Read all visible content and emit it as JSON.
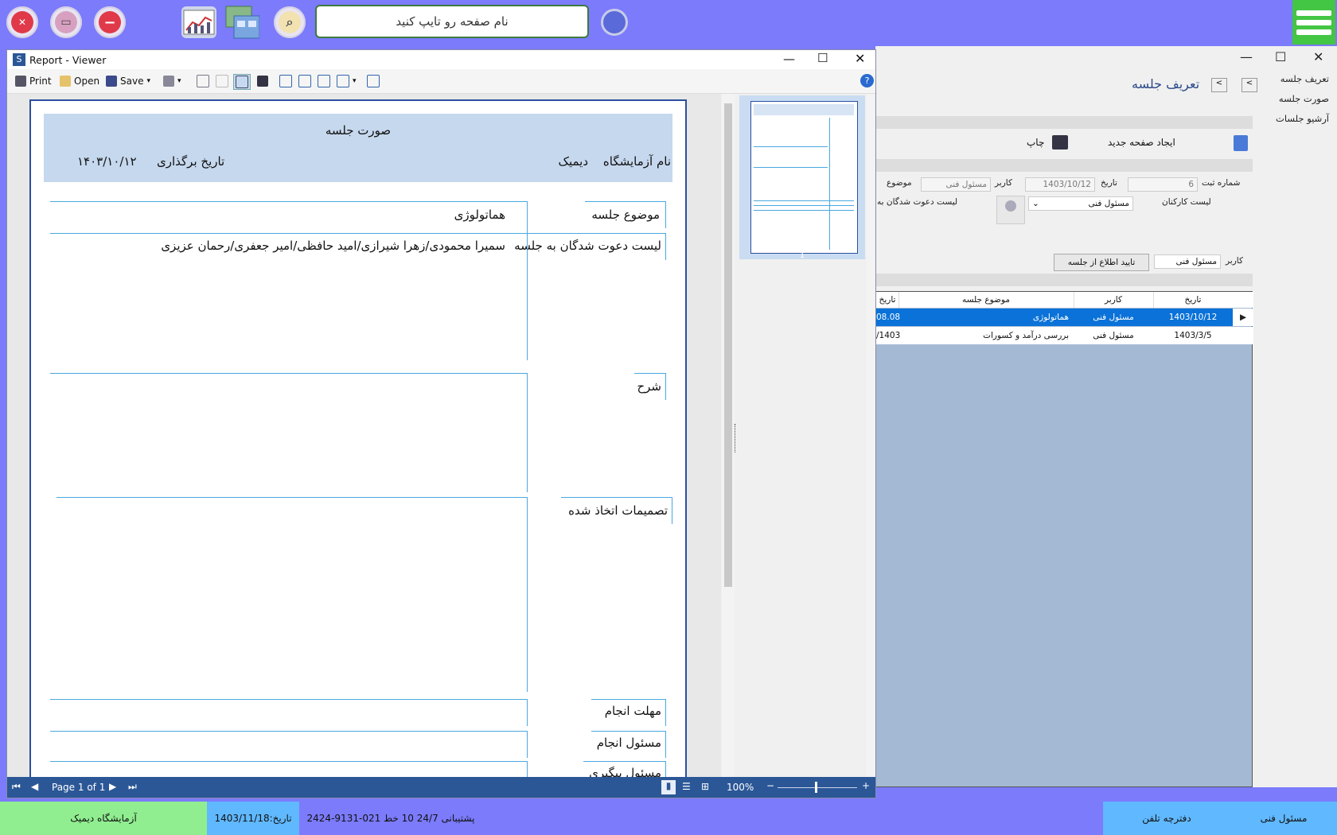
{
  "topbar": {
    "search_placeholder": "نام صفحه رو تایپ کنید"
  },
  "viewer": {
    "title": "Report - Viewer",
    "toolbar": {
      "print": "Print",
      "open": "Open",
      "save": "Save"
    },
    "report": {
      "title": "صورت جلسه",
      "lab_label": "نام آزمایشگاه",
      "lab_value": "دیمیک",
      "date_label": "تاریخ برگذاری",
      "date_value": "۱۴۰۳/۱۰/۱۲",
      "subject_label": "موضوع جلسه",
      "subject_value": "هماتولوژی",
      "invitees_label": "لیست دعوت شدگان به جلسه",
      "invitees_value": "سمیرا محمودی/زهرا شیرازی/امید حافظی/امیر جعفری/رحمان عزیزی",
      "description_label": "شرح",
      "decisions_label": "تصمیمات اتخاذ شده",
      "deadline_label": "مهلت انجام",
      "responsible_label": "مسئول انجام",
      "followup_label": "مسئول پیگیری"
    },
    "thumbnail_page": "1",
    "status": {
      "page": "Page 1 of 1",
      "zoom": "100%"
    }
  },
  "form": {
    "title": "تعریف جلسه",
    "side_links": [
      "تعریف جلسه",
      "صورت جلسه",
      "آرشیو جلسات"
    ],
    "print_label": "چاپ",
    "new_page_label": "ایجاد صفحه جدید",
    "reg_number_label": "شماره ثبت",
    "reg_number_value": "6",
    "date_label": "تاریخ",
    "date_value": "1403/10/12",
    "user_label": "کاربر",
    "user_value": "مسئول فنی",
    "subject_label": "موضوع",
    "staff_list_label": "لیست کارکنان",
    "staff_select_value": "مسئول فنی",
    "invitees_label": "لیست دعوت شدگان به",
    "user2_label": "کاربر",
    "user2_value": "مسئول فنی",
    "confirm_button": "تایید اطلاع از جلسه",
    "grid": {
      "headers": [
        "تاریخ",
        "کاربر",
        "موضوع جلسه",
        "تاریخ"
      ],
      "rows": [
        {
          "date": "1403/10/12",
          "user": "مسئول فنی",
          "subject": "هماتولوژی",
          "date2": "08.08"
        },
        {
          "date": "1403/3/5",
          "user": "مسئول فنی",
          "subject": "بررسی درآمد و کسورات",
          "date2": "/1403"
        }
      ]
    }
  },
  "bottombar": {
    "lab": "آزمایشگاه دیمیک",
    "date": "تاریخ:1403/11/18",
    "support": "پشتیبانی 24/7   10 خط   021-9131-2424",
    "phonebook": "دفترچه تلفن",
    "user": "مسئول فنی"
  }
}
